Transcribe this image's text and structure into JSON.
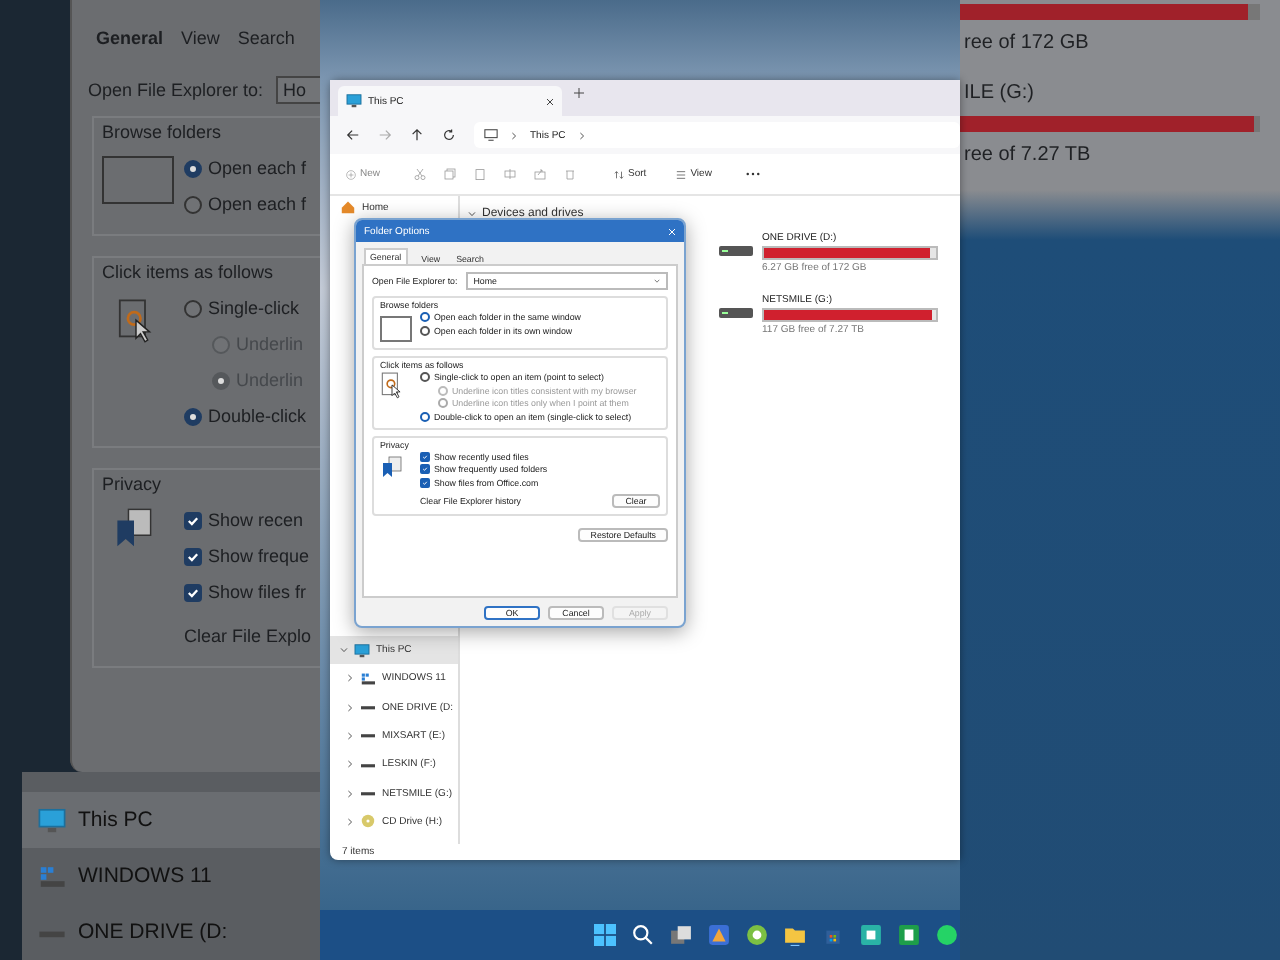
{
  "left_backdrop": {
    "tabs": [
      {
        "label": "General",
        "selected": true
      },
      {
        "label": "View",
        "selected": false
      },
      {
        "label": "Search",
        "selected": false
      }
    ],
    "open_to_label": "Open File Explorer to:",
    "open_to_value": "Ho",
    "browse_title": "Browse folders",
    "browse_options": [
      {
        "label": "Open each f",
        "selected": true
      },
      {
        "label": "Open each f",
        "selected": false
      }
    ],
    "click_title": "Click items as follows",
    "click_options": [
      {
        "label": "Single-click",
        "selected": false,
        "disabled": false,
        "sub": false
      },
      {
        "label": "Underlin",
        "selected": false,
        "disabled": true,
        "sub": true
      },
      {
        "label": "Underlin",
        "selected": true,
        "disabled": true,
        "sub": true
      },
      {
        "label": "Double-click",
        "selected": true,
        "disabled": false,
        "sub": false
      }
    ],
    "privacy_title": "Privacy",
    "privacy_options": [
      {
        "label": "Show recen",
        "checked": true
      },
      {
        "label": "Show freque",
        "checked": true
      },
      {
        "label": "Show files fr",
        "checked": true
      }
    ],
    "clear_label": "Clear File Explo",
    "nav_items": [
      {
        "label": "This PC",
        "selected": true,
        "kind": "pc"
      },
      {
        "label": "WINDOWS 11",
        "selected": false,
        "kind": "system"
      },
      {
        "label": "ONE DRIVE (D:",
        "selected": false,
        "kind": "drive"
      }
    ]
  },
  "explorer": {
    "tab": {
      "title": "This PC"
    },
    "breadcrumb": [
      "This PC"
    ],
    "toolbar": {
      "new": "New",
      "sort": "Sort",
      "view": "View"
    },
    "sidebar": {
      "top": [
        {
          "label": "Home",
          "selected": false,
          "kind": "home"
        }
      ],
      "items": [
        {
          "label": "This PC",
          "selected": true,
          "kind": "pc",
          "expanded": true
        },
        {
          "label": "WINDOWS 11",
          "selected": false,
          "kind": "system",
          "expanded": false
        },
        {
          "label": "ONE DRIVE (D:",
          "selected": false,
          "kind": "drive",
          "expanded": false
        },
        {
          "label": "MIXSART (E:)",
          "selected": false,
          "kind": "drive",
          "expanded": false
        },
        {
          "label": "LESKIN (F:)",
          "selected": false,
          "kind": "drive",
          "expanded": false
        },
        {
          "label": "NETSMILE (G:)",
          "selected": false,
          "kind": "drive",
          "expanded": false
        },
        {
          "label": "CD Drive (H:)",
          "selected": false,
          "kind": "cd",
          "expanded": false
        }
      ]
    },
    "section": "Devices and drives",
    "drives": [
      {
        "name": "ONE DRIVE (D:)",
        "free": "6.27 GB free of 172 GB",
        "level": 0.96
      },
      {
        "name": "NETSMILE (G:)",
        "free": "117 GB free of 7.27 TB",
        "level": 0.98
      }
    ],
    "status": "7 items"
  },
  "folder_options": {
    "title": "Folder Options",
    "tabs": [
      {
        "label": "General",
        "selected": true
      },
      {
        "label": "View",
        "selected": false
      },
      {
        "label": "Search",
        "selected": false
      }
    ],
    "open_to_label": "Open File Explorer to:",
    "open_to_value": "Home",
    "browse_title": "Browse folders",
    "browse_options": [
      {
        "label": "Open each folder in the same window",
        "selected": true
      },
      {
        "label": "Open each folder in its own window",
        "selected": false
      }
    ],
    "click_title": "Click items as follows",
    "click_options": [
      {
        "label": "Single-click to open an item (point to select)",
        "selected": false,
        "disabled": false,
        "sub": false
      },
      {
        "label": "Underline icon titles consistent with my browser",
        "selected": false,
        "disabled": true,
        "sub": true
      },
      {
        "label": "Underline icon titles only when I point at them",
        "selected": true,
        "disabled": true,
        "sub": true
      },
      {
        "label": "Double-click to open an item (single-click to select)",
        "selected": true,
        "disabled": false,
        "sub": false
      }
    ],
    "privacy_title": "Privacy",
    "privacy_options": [
      {
        "label": "Show recently used files",
        "checked": true
      },
      {
        "label": "Show frequently used folders",
        "checked": true
      },
      {
        "label": "Show files from Office.com",
        "checked": true
      }
    ],
    "clear_label": "Clear File Explorer history",
    "clear_button": "Clear",
    "restore_button": "Restore Defaults",
    "buttons": [
      {
        "label": "OK",
        "disabled": false,
        "default": true
      },
      {
        "label": "Cancel",
        "disabled": false,
        "default": false
      },
      {
        "label": "Apply",
        "disabled": true,
        "default": false
      }
    ]
  },
  "right_backdrop": {
    "lines": [
      {
        "text": "ree of 172 GB",
        "kind": "free",
        "level": 0.96
      },
      {
        "text": "ILE (G:)",
        "kind": "name"
      },
      {
        "text": "ree of 7.27 TB",
        "kind": "free",
        "level": 0.98
      }
    ]
  }
}
